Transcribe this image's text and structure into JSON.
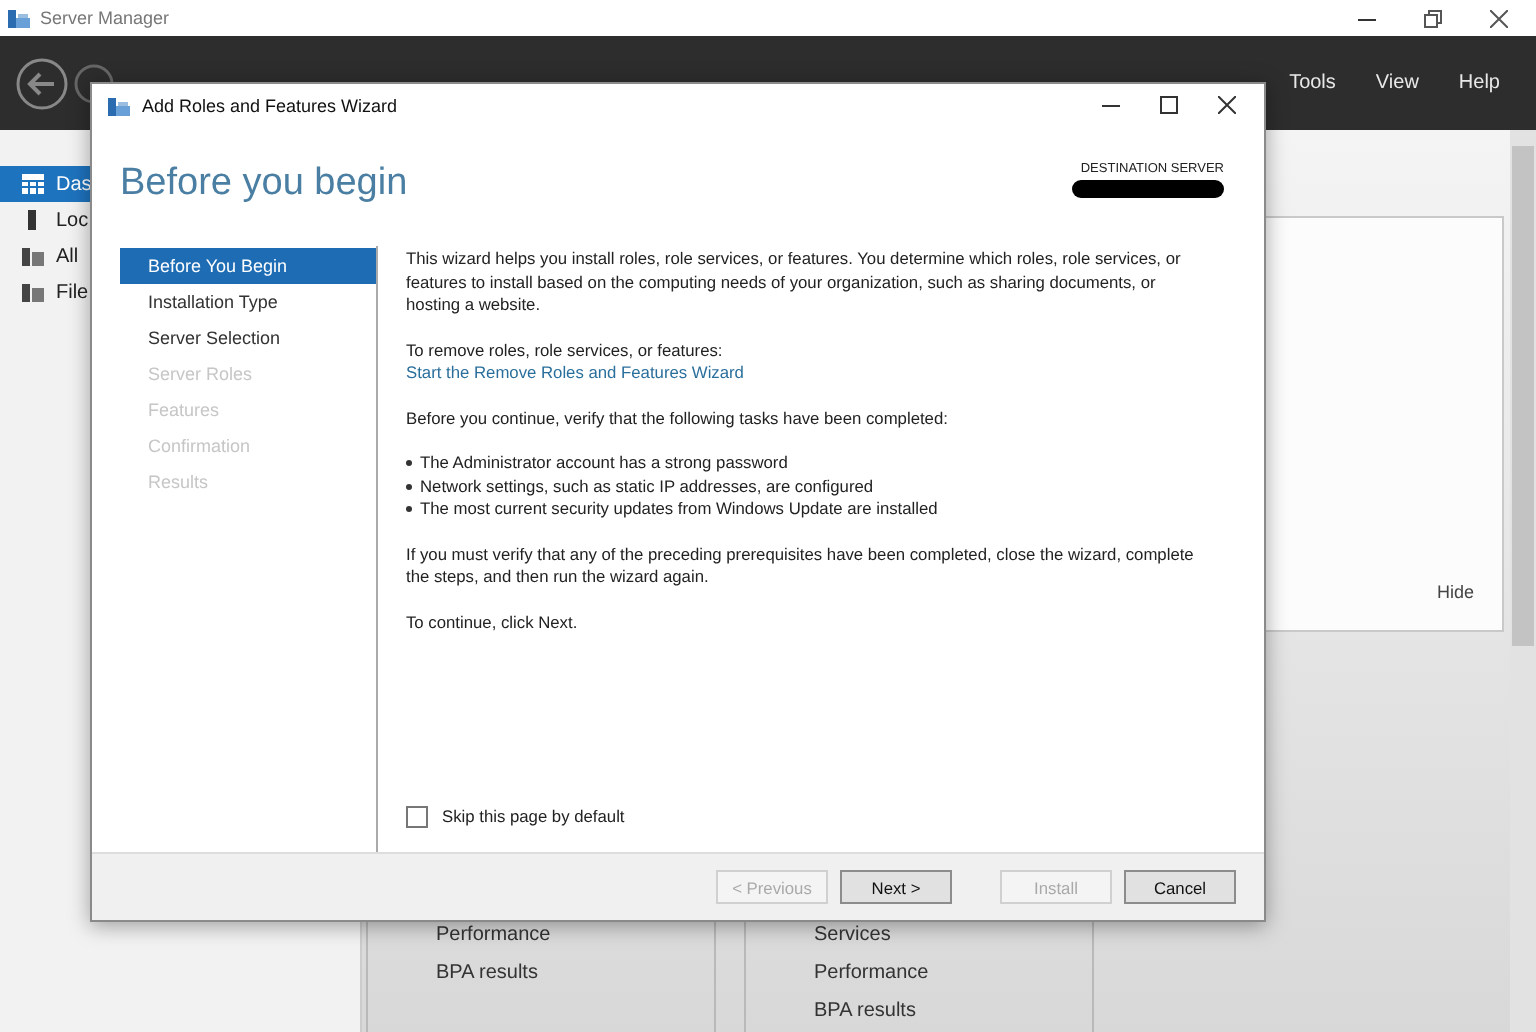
{
  "window": {
    "title": "Server Manager"
  },
  "menu": [
    "Tools",
    "View",
    "Help"
  ],
  "sidebar": {
    "items": [
      {
        "label": "Das",
        "selected": true
      },
      {
        "label": "Loc",
        "selected": false
      },
      {
        "label": "All",
        "selected": false
      },
      {
        "label": "File",
        "selected": false
      }
    ]
  },
  "welcome_panel": {
    "hide_link": "Hide"
  },
  "tiles": [
    {
      "items": [
        "Performance",
        "BPA results"
      ]
    },
    {
      "items": [
        "Services",
        "Performance",
        "BPA results"
      ]
    }
  ],
  "wizard": {
    "title": "Add Roles and Features Wizard",
    "heading": "Before you begin",
    "destination_label": "DESTINATION SERVER",
    "steps": [
      {
        "label": "Before You Begin",
        "selected": true,
        "disabled": false
      },
      {
        "label": "Installation Type",
        "selected": false,
        "disabled": false
      },
      {
        "label": "Server Selection",
        "selected": false,
        "disabled": false
      },
      {
        "label": "Server Roles",
        "selected": false,
        "disabled": true
      },
      {
        "label": "Features",
        "selected": false,
        "disabled": true
      },
      {
        "label": "Confirmation",
        "selected": false,
        "disabled": true
      },
      {
        "label": "Results",
        "selected": false,
        "disabled": true
      }
    ],
    "intro": "This wizard helps you install roles, role services, or features. You determine which roles, role services, or features to install based on the computing needs of your organization, such as sharing documents, or hosting a website.",
    "remove_label": "To remove roles, role services, or features:",
    "remove_link": "Start the Remove Roles and Features Wizard",
    "verify_label": "Before you continue, verify that the following tasks have been completed:",
    "tasks": [
      "The Administrator account has a strong password",
      "Network settings, such as static IP addresses, are configured",
      "The most current security updates from Windows Update are installed"
    ],
    "note": "If you must verify that any of the preceding prerequisites have been completed, close the wizard, complete the steps, and then run the wizard again.",
    "continue_text": "To continue, click Next.",
    "skip_checkbox": {
      "label": "Skip this page by default",
      "checked": false
    },
    "buttons": [
      {
        "label": "< Previous",
        "disabled": true
      },
      {
        "label": "Next >",
        "disabled": false
      },
      {
        "label": "Install",
        "disabled": true
      },
      {
        "label": "Cancel",
        "disabled": false
      }
    ]
  }
}
